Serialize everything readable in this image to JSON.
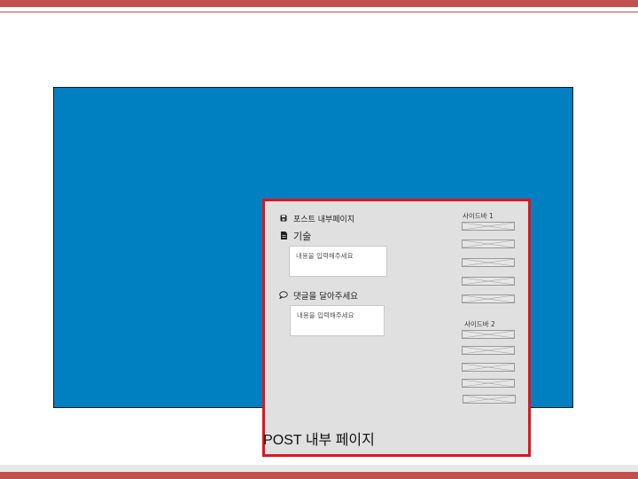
{
  "post": {
    "title": "포스트 내부페이지",
    "category": "기술",
    "content_placeholder": "내용을 입력해주세요",
    "comment_heading": "댓글을 달아주세요",
    "comment_placeholder": "내용을 입력해주세요"
  },
  "sidebar": {
    "section1_label": "사이드바 1",
    "section2_label": "사이드바 2"
  },
  "caption": "POST 내부 페이지",
  "icons": {
    "title": "save-icon",
    "category": "file-icon",
    "comment": "comment-icon"
  },
  "colors": {
    "accent_red": "#c0504d",
    "frame_blue": "#0080c0",
    "page_border": "#e0141e",
    "page_bg": "#e0e0e0"
  }
}
